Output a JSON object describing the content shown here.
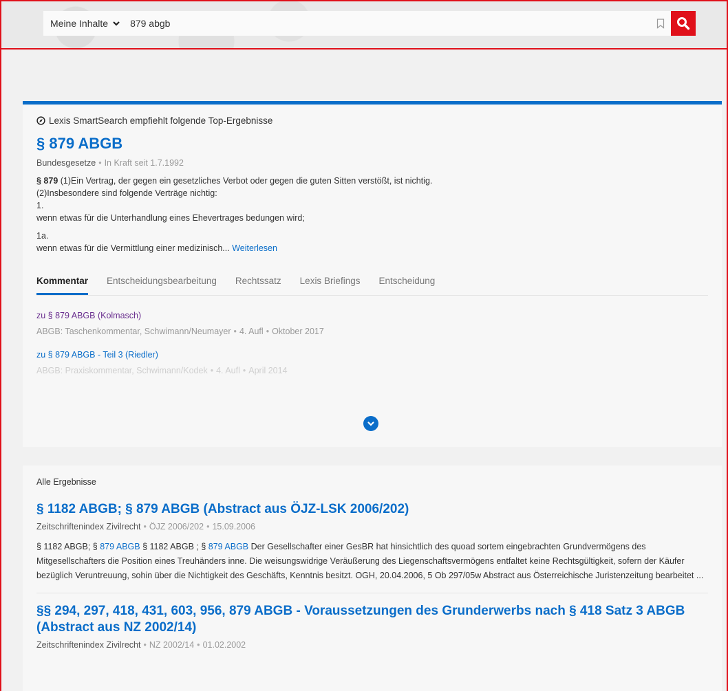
{
  "search": {
    "scope_label": "Meine Inhalte",
    "query": "879 abgb"
  },
  "top": {
    "smartsearch_label": "Lexis SmartSearch empfiehlt folgende Top-Ergebnisse",
    "title": "§ 879 ABGB",
    "source": "Bundesgesetze",
    "status": "In Kraft seit 1.7.1992",
    "para_bold": "§ 879",
    "line1": "(1)Ein Vertrag, der gegen ein gesetzliches Verbot oder gegen die guten Sitten verstößt, ist nichtig.",
    "line2": "(2)Insbesondere sind folgende Verträge nichtig:",
    "line3": "1.",
    "line4": "wenn etwas für die Unterhandlung eines Ehevertrages bedungen wird;",
    "line5": "1a.",
    "line6": "wenn etwas für die Vermittlung einer medizinisch...",
    "read_more": "Weiterlesen",
    "tabs": [
      {
        "label": "Kommentar"
      },
      {
        "label": "Entscheidungsbearbeitung"
      },
      {
        "label": "Rechtssatz"
      },
      {
        "label": "Lexis Briefings"
      },
      {
        "label": "Entscheidung"
      }
    ],
    "subresults": [
      {
        "title": "zu § 879 ABGB (Kolmasch)",
        "work": "ABGB: Taschenkommentar, Schwimann/Neumayer",
        "edition": "4. Aufl",
        "date": "Oktober 2017"
      },
      {
        "title": "zu § 879 ABGB - Teil 3 (Riedler)",
        "work": "ABGB: Praxiskommentar, Schwimann/Kodek",
        "edition": "4. Aufl",
        "date": "April 2014"
      }
    ]
  },
  "all": {
    "heading": "Alle Ergebnisse",
    "results": [
      {
        "title": "§ 1182 ABGB; § 879 ABGB (Abstract aus ÖJZ-LSK 2006/202)",
        "source": "Zeitschriftenindex Zivilrecht",
        "ref": "ÖJZ 2006/202",
        "date": "15.09.2006",
        "snip_a": "§ 1182 ABGB; §",
        "snip_link1": "879 ABGB",
        "snip_b": "§ 1182 ABGB ; §",
        "snip_link2": "879 ABGB",
        "snip_c": "Der Gesellschafter einer GesBR hat hinsichtlich des quoad sortem eingebrachten Grundvermögens des Mitgesellschafters die Position eines Treuhänders inne. Die weisungswidrige Veräußerung des Liegenschaftsvermögens entfaltet keine Rechtsgültigkeit, sofern der Käufer bezüglich Veruntreuung, sohin über die Nichtigkeit des Geschäfts, Kenntnis besitzt. OGH, 20.04.2006, 5 Ob 297/05w Abstract aus Österreichische Juristenzeitung bearbeitet ..."
      },
      {
        "title": "§§ 294, 297, 418, 431, 603, 956, 879 ABGB - Voraussetzungen des Grunderwerbs nach § 418 Satz 3 ABGB (Abstract aus NZ 2002/14)",
        "source": "Zeitschriftenindex Zivilrecht",
        "ref": "NZ 2002/14",
        "date": "01.02.2002"
      }
    ]
  }
}
